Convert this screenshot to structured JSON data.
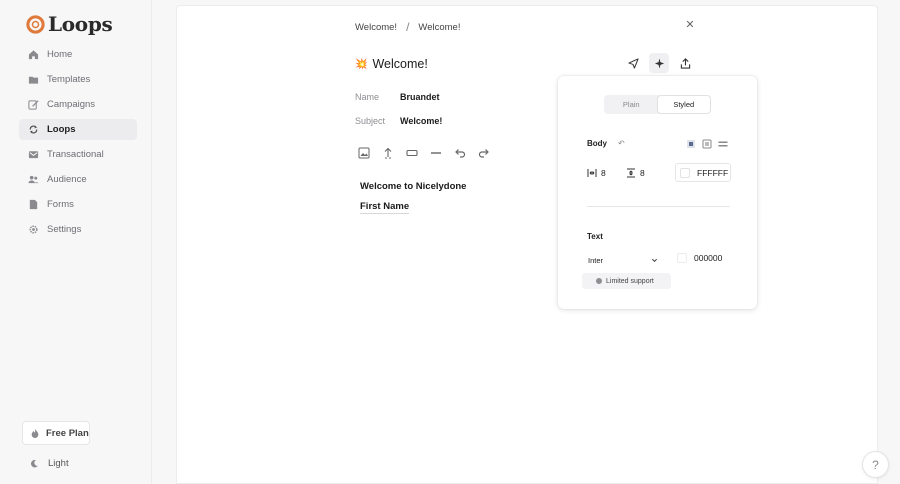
{
  "app": {
    "name": "Loops"
  },
  "colors": {
    "brand": "#e07a3a",
    "accent_emoji": "#e0552b"
  },
  "sidebar": {
    "items": [
      {
        "label": "Home",
        "icon": "home-icon"
      },
      {
        "label": "Templates",
        "icon": "folder-icon"
      },
      {
        "label": "Campaigns",
        "icon": "pencil-icon"
      },
      {
        "label": "Loops",
        "icon": "loop-icon",
        "active": true
      },
      {
        "label": "Transactional",
        "icon": "mail-icon"
      },
      {
        "label": "Audience",
        "icon": "users-icon"
      },
      {
        "label": "Forms",
        "icon": "form-icon"
      },
      {
        "label": "Settings",
        "icon": "gear-icon"
      }
    ],
    "plan_label": "Free Plan",
    "theme_label": "Light"
  },
  "editor": {
    "breadcrumbs": [
      "Welcome!",
      "Welcome!"
    ],
    "title": "Welcome!",
    "title_emoji": "💥",
    "fields": [
      {
        "label": "Name",
        "value": "Bruandet"
      },
      {
        "label": "Subject",
        "value": "Welcome!"
      }
    ],
    "content": [
      "Welcome to Nicelydone",
      "First Name"
    ]
  },
  "style_panel": {
    "tabs": [
      "Plain",
      "Styled"
    ],
    "active_tab": "Styled",
    "body_label": "Body",
    "padding_x": "8",
    "padding_y": "8",
    "background_color": "FFFFFF",
    "text_label": "Text",
    "font": "Inter",
    "text_color": "000000",
    "limited_support": "Limited support"
  },
  "help_label": "?"
}
